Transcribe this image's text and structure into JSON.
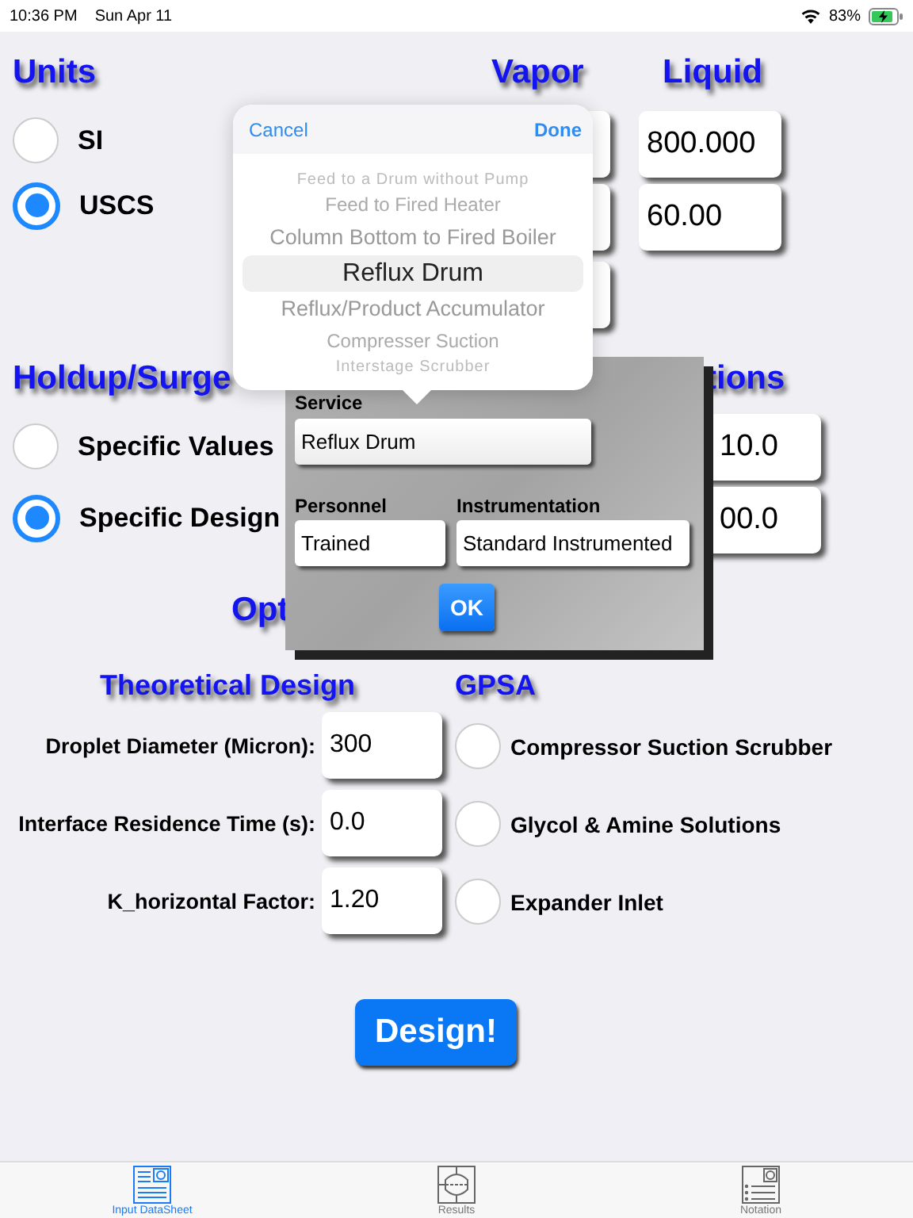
{
  "status_bar": {
    "time": "10:36 PM",
    "date": "Sun Apr 11",
    "battery": "83%"
  },
  "units": {
    "heading": "Units",
    "options": [
      {
        "label": "SI",
        "selected": false
      },
      {
        "label": "USCS",
        "selected": true
      }
    ]
  },
  "flow": {
    "vapor_heading": "Vapor",
    "liquid_heading": "Liquid",
    "liquid_values": [
      "800.000",
      "60.00"
    ]
  },
  "holdup": {
    "heading": "Holdup/Surge",
    "options": [
      {
        "label": "Specific Values",
        "selected": false
      },
      {
        "label": "Specific Design",
        "selected": true
      }
    ]
  },
  "conditions": {
    "heading": "tions",
    "values": [
      "10.0",
      "00.0"
    ]
  },
  "options_heading": "Opt",
  "theoretical": {
    "heading": "Theoretical Design",
    "fields": [
      {
        "label": "Droplet Diameter (Micron):",
        "value": "300"
      },
      {
        "label": "Interface Residence Time (s):",
        "value": "0.0"
      },
      {
        "label": "K_horizontal Factor:",
        "value": "1.20"
      }
    ]
  },
  "gpsa": {
    "heading": "GPSA",
    "options": [
      {
        "label": "Compressor Suction Scrubber",
        "selected": false
      },
      {
        "label": "Glycol & Amine Solutions",
        "selected": false
      },
      {
        "label": "Expander Inlet",
        "selected": false
      }
    ]
  },
  "design_button": "Design!",
  "tabs": [
    {
      "label": "Input DataSheet",
      "selected": true
    },
    {
      "label": "Results",
      "selected": false
    },
    {
      "label": "Notation",
      "selected": false
    }
  ],
  "dialog": {
    "service_label": "Service",
    "service": "Reflux Drum",
    "personnel_label": "Personnel",
    "personnel": "Trained",
    "instrumentation_label": "Instrumentation",
    "instrumentation": "Standard Instrumented",
    "ok": "OK"
  },
  "picker": {
    "cancel": "Cancel",
    "done": "Done",
    "items": [
      {
        "label": "Feed to a Drum without Pump",
        "selected": false
      },
      {
        "label": "Feed to Fired Heater",
        "selected": false
      },
      {
        "label": "Column Bottom to Fired Boiler",
        "selected": false
      },
      {
        "label": "Reflux Drum",
        "selected": true
      },
      {
        "label": "Reflux/Product Accumulator",
        "selected": false
      },
      {
        "label": "Compresser Suction",
        "selected": false
      },
      {
        "label": "Interstage Scrubber",
        "selected": false
      }
    ]
  }
}
